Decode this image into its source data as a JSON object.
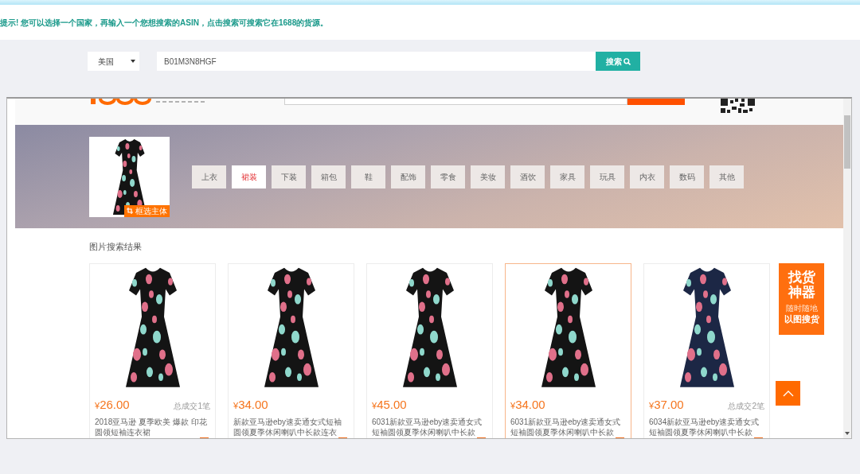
{
  "notice": {
    "text": "提示! 您可以选择一个国家，再输入一个您想搜索的ASIN，点击搜索可搜索它在1688的货源。"
  },
  "search": {
    "country": "美国",
    "asin": "B01M3N8HGF",
    "button": "搜索"
  },
  "embedded_page": {
    "query_image": {
      "crop_label": "框选主体"
    },
    "categories": [
      {
        "label": "上衣",
        "selected": false
      },
      {
        "label": "裙装",
        "selected": true
      },
      {
        "label": "下装",
        "selected": false
      },
      {
        "label": "箱包",
        "selected": false
      },
      {
        "label": "鞋",
        "selected": false
      },
      {
        "label": "配饰",
        "selected": false
      },
      {
        "label": "零食",
        "selected": false
      },
      {
        "label": "美妆",
        "selected": false
      },
      {
        "label": "酒饮",
        "selected": false
      },
      {
        "label": "家具",
        "selected": false
      },
      {
        "label": "玩具",
        "selected": false
      },
      {
        "label": "内衣",
        "selected": false
      },
      {
        "label": "数码",
        "selected": false
      },
      {
        "label": "其他",
        "selected": false
      }
    ],
    "results_title": "图片搜索结果",
    "results": [
      {
        "currency": "¥",
        "price": "26.00",
        "sales": "总成交1笔",
        "title": "2018亚马逊 夏季欧美 爆款 印花圆领短袖连衣裙",
        "selected": false,
        "color": "#141414"
      },
      {
        "currency": "¥",
        "price": "34.00",
        "title": "新款亚马逊eby速卖通女式短袖圆领夏季休闲喇叭中长款连衣",
        "selected": false,
        "color": "#141414"
      },
      {
        "currency": "¥",
        "price": "45.00",
        "title": "6031新款亚马逊eby速卖通女式短袖圆领夏季休闲喇叭中长款",
        "selected": false,
        "color": "#141414"
      },
      {
        "currency": "¥",
        "price": "34.00",
        "title": "6031新款亚马逊eby速卖通女式短袖圆领夏季休闲喇叭中长款",
        "selected": true,
        "color": "#141414"
      },
      {
        "currency": "¥",
        "price": "37.00",
        "sales": "总成交2笔",
        "title": "6034新款亚马逊eby速卖通女式短袖圆领夏季休闲喇叭中长款",
        "selected": false,
        "color": "#1c2745"
      }
    ],
    "promo": {
      "title": "找货神器",
      "subtitle": "随时随地",
      "action": "以图搜货"
    }
  }
}
